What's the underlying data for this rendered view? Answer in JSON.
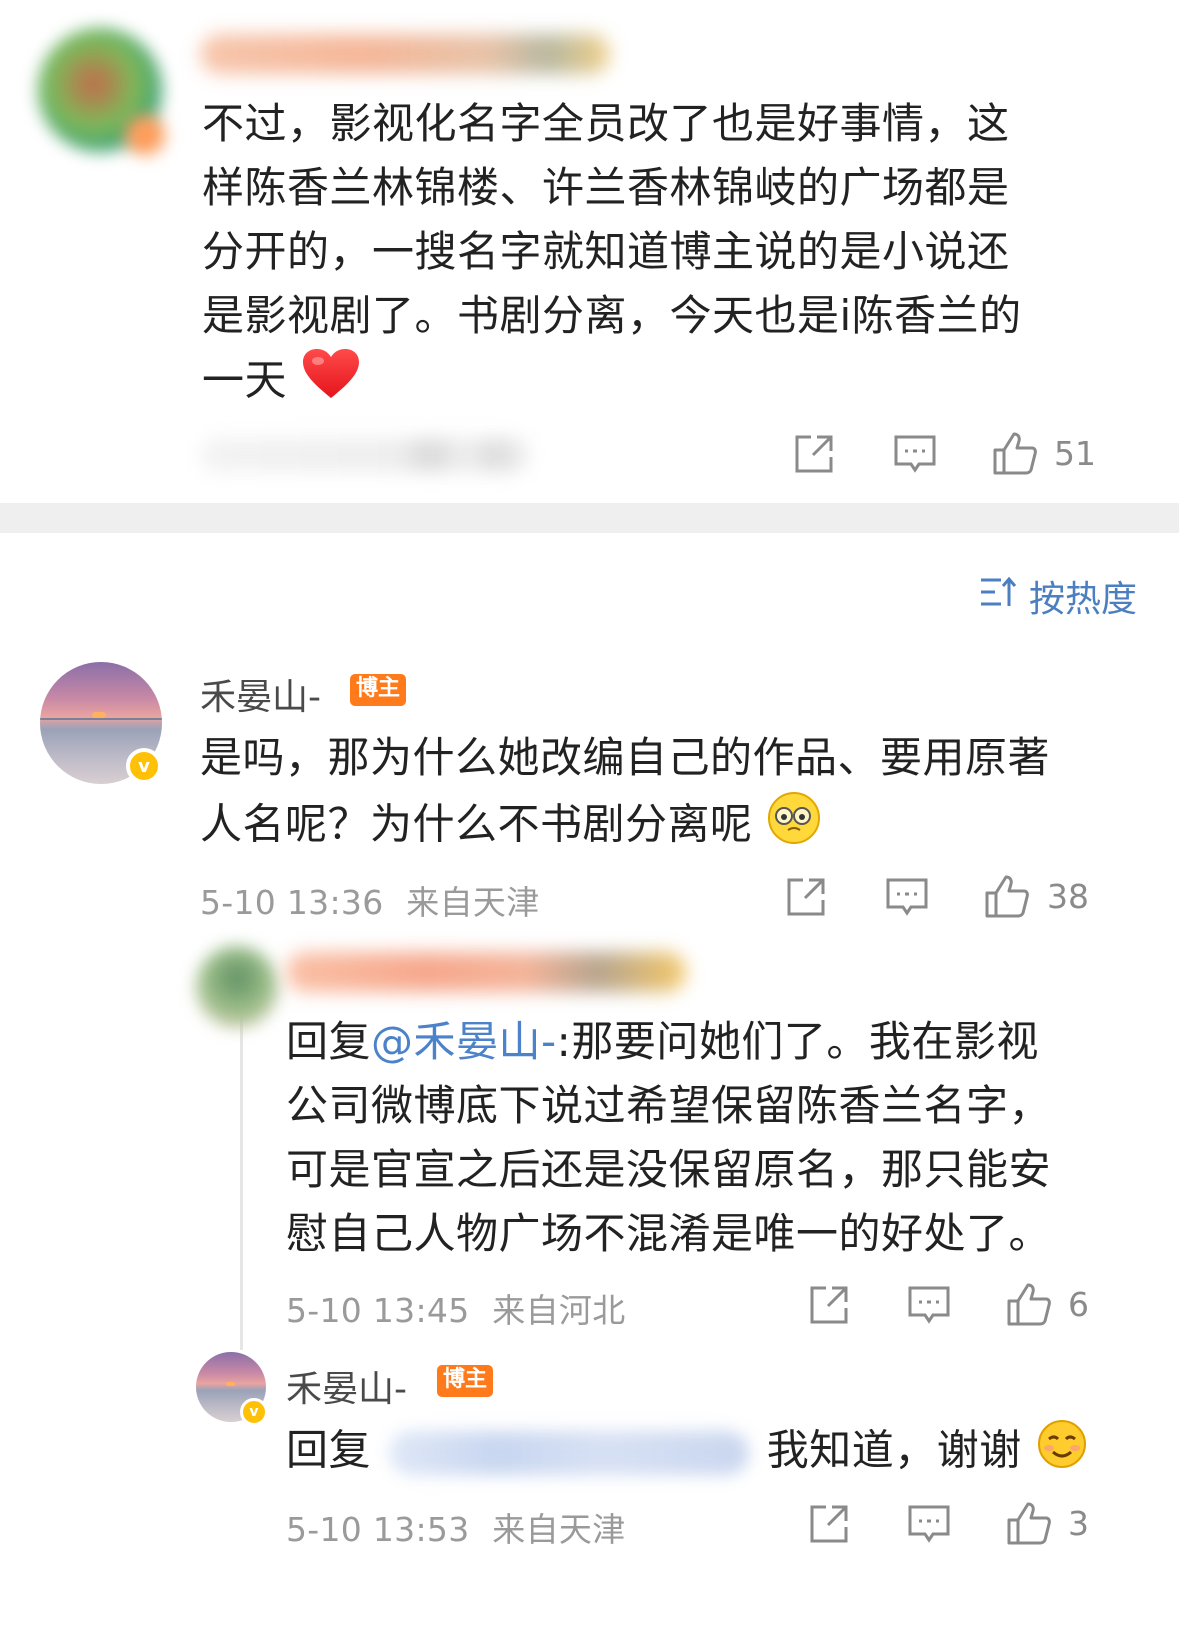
{
  "top_comment": {
    "text_lines": [
      "不过，影视化名字全员改了也是好事情，这",
      "样陈香兰林锦楼、许兰香林锦岐的广场都是",
      "分开的，一搜名字就知道博主说的是小说还",
      "是影视剧了。书剧分离，今天也是i陈香兰的",
      "一天"
    ],
    "emoji": "heart",
    "like_count": "51"
  },
  "sort": {
    "label": "按热度",
    "icon": "sort-icon"
  },
  "comment_1": {
    "author": "禾晏山-",
    "badge": "博主",
    "text_lines": [
      "是吗，那为什么她改编自己的作品、要用原著",
      "人名呢？为什么不书剧分离呢"
    ],
    "emoji": "facepalm",
    "time": "5-10 13:36",
    "location": "来自天津",
    "like_count": "38"
  },
  "reply_1": {
    "reply_prefix": "回复",
    "mention": "@禾晏山-",
    "text_lines_first": ":那要问她们了。我在影视",
    "text_lines": [
      "公司微博底下说过希望保留陈香兰名字，",
      "可是官宣之后还是没保留原名，那只能安",
      "慰自己人物广场不混淆是唯一的好处了。"
    ],
    "time": "5-10 13:45",
    "location": "来自河北",
    "like_count": "6"
  },
  "reply_2": {
    "author": "禾晏山-",
    "badge": "博主",
    "reply_prefix": "回复",
    "text": "我知道，谢谢",
    "emoji": "smile",
    "time": "5-10 13:53",
    "location": "来自天津",
    "like_count": "3"
  },
  "colors": {
    "accent_blue": "#4c7fc0",
    "badge_orange": "#ff7a1a",
    "verified_yellow": "#ffc107",
    "meta_gray": "#9a9a9a"
  }
}
